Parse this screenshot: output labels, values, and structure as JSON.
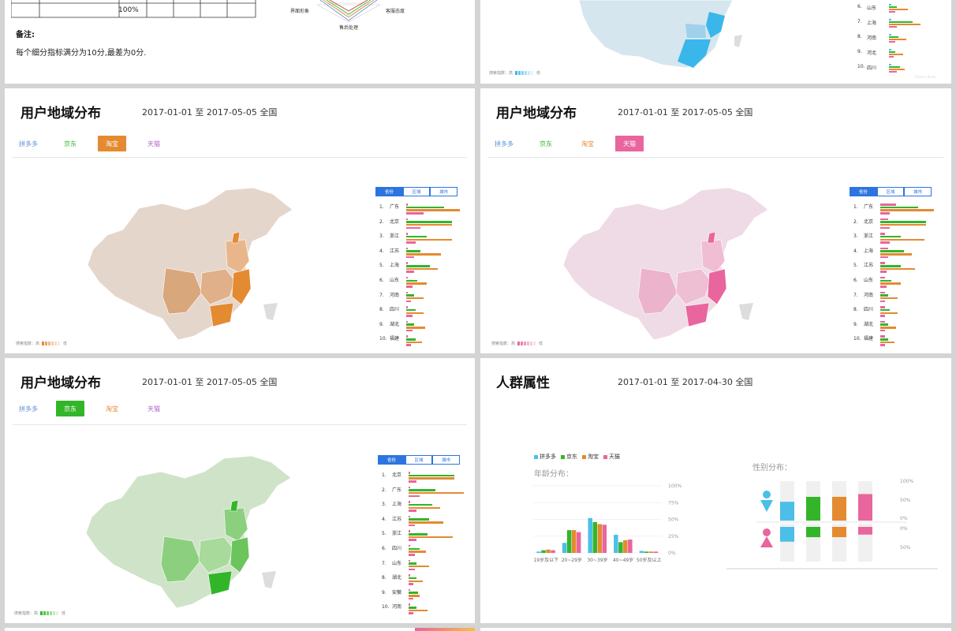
{
  "colors": {
    "pdd": "#5b8fd6",
    "jd": "#33b52a",
    "tb": "#e48a30",
    "tm": "#e9659d",
    "blue": "#2d74e0"
  },
  "top_left": {
    "table_total": "100%",
    "note_title": "备注:",
    "note_text": "每个细分指标满分为10分,最差为0分.",
    "radar_labels": [
      "界面形象",
      "售后处理",
      "客服态度"
    ]
  },
  "top_right": {
    "ranks": [
      "6.",
      "山东",
      "7.",
      "上海",
      "8.",
      "河南",
      "9.",
      "河北",
      "10.",
      "四川"
    ],
    "legend_label": "搜索指数：高",
    "legend_low": "低",
    "watermark": "©Baidu  Baidu"
  },
  "region_panels": [
    {
      "title": "用户地域分布",
      "date": "2017-01-01 至 2017-05-05  全国",
      "tabs": [
        "拼多多",
        "京东",
        "淘宝",
        "天猫"
      ],
      "active_tab": 2,
      "toggle": [
        "省份",
        "区域",
        "城市"
      ],
      "rows": [
        [
          "1.",
          "广东"
        ],
        [
          "2.",
          "北京"
        ],
        [
          "3.",
          "浙江"
        ],
        [
          "4.",
          "江苏"
        ],
        [
          "5.",
          "上海"
        ],
        [
          "6.",
          "山东"
        ],
        [
          "7.",
          "河南"
        ],
        [
          "8.",
          "四川"
        ],
        [
          "9.",
          "湖北"
        ],
        [
          "10.",
          "福建"
        ]
      ],
      "legend_high": "搜索指数：高",
      "legend_low": "低"
    },
    {
      "title": "用户地域分布",
      "date": "2017-01-01 至 2017-05-05  全国",
      "tabs": [
        "拼多多",
        "京东",
        "淘宝",
        "天猫"
      ],
      "active_tab": 3,
      "toggle": [
        "省份",
        "区域",
        "城市"
      ],
      "rows": [
        [
          "1.",
          "广东"
        ],
        [
          "2.",
          "北京"
        ],
        [
          "3.",
          "浙江"
        ],
        [
          "4.",
          "上海"
        ],
        [
          "5.",
          "江苏"
        ],
        [
          "6.",
          "山东"
        ],
        [
          "7.",
          "河南"
        ],
        [
          "8.",
          "四川"
        ],
        [
          "9.",
          "湖北"
        ],
        [
          "10.",
          "福建"
        ]
      ],
      "legend_high": "搜索指数：高",
      "legend_low": "低"
    },
    {
      "title": "用户地域分布",
      "date": "2017-01-01 至 2017-05-05  全国",
      "tabs": [
        "拼多多",
        "京东",
        "淘宝",
        "天猫"
      ],
      "active_tab": 1,
      "toggle": [
        "省份",
        "区域",
        "城市"
      ],
      "rows": [
        [
          "1.",
          "北京"
        ],
        [
          "2.",
          "广东"
        ],
        [
          "3.",
          "上海"
        ],
        [
          "4.",
          "江苏"
        ],
        [
          "5.",
          "浙江"
        ],
        [
          "6.",
          "四川"
        ],
        [
          "7.",
          "山东"
        ],
        [
          "8.",
          "湖北"
        ],
        [
          "9.",
          "安徽"
        ],
        [
          "10.",
          "河南"
        ]
      ],
      "legend_high": "搜索指数：高",
      "legend_low": "低"
    }
  ],
  "crowd": {
    "title": "人群属性",
    "date": "2017-01-01 至 2017-04-30  全国",
    "age_title": "年龄分布：",
    "gender_title": "性别分布："
  },
  "chart_data": [
    {
      "type": "bar",
      "title": "年龄分布：",
      "categories": [
        "19岁及以下",
        "20~29岁",
        "30~39岁",
        "40~49岁",
        "50岁及以上"
      ],
      "series": [
        {
          "name": "拼多多",
          "color": "#4bbfe8",
          "values": [
            2,
            15,
            52,
            27,
            3
          ]
        },
        {
          "name": "京东",
          "color": "#33b52a",
          "values": [
            4,
            34,
            46,
            16,
            2
          ]
        },
        {
          "name": "淘宝",
          "color": "#e48a30",
          "values": [
            5,
            34,
            43,
            19,
            2
          ]
        },
        {
          "name": "天猫",
          "color": "#e9659d",
          "values": [
            4,
            31,
            42,
            20,
            2
          ]
        }
      ],
      "ylim": [
        0,
        100
      ],
      "yticks": [
        "0%",
        "25%",
        "50%",
        "75%",
        "100%"
      ]
    },
    {
      "type": "bar",
      "title": "性别分布：",
      "categories": [
        "男",
        "女"
      ],
      "series": [
        {
          "name": "拼多多",
          "color": "#4bbfe8",
          "values": [
            54,
            46
          ]
        },
        {
          "name": "京东",
          "color": "#33b52a",
          "values": [
            68,
            32
          ]
        },
        {
          "name": "淘宝",
          "color": "#e48a30",
          "values": [
            68,
            32
          ]
        },
        {
          "name": "天猫",
          "color": "#e9659d",
          "values": [
            76,
            24
          ]
        }
      ],
      "yticks_top": [
        "100%",
        "50%",
        "0%"
      ],
      "yticks_bottom": [
        "0%",
        "50%"
      ]
    }
  ]
}
